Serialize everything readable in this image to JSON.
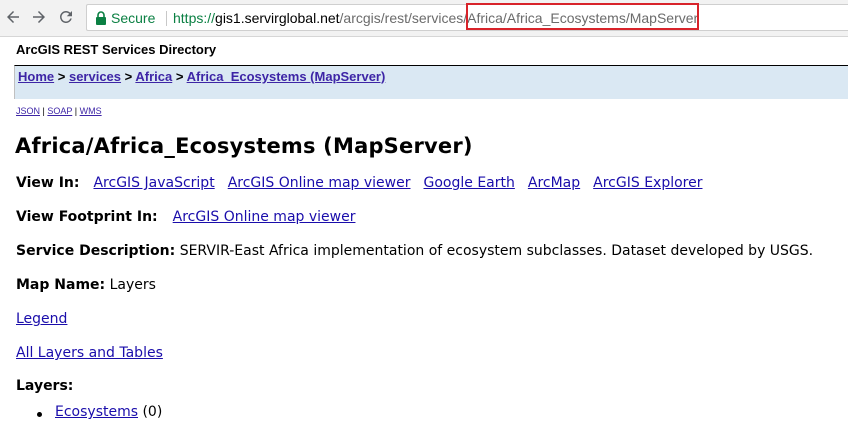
{
  "browser": {
    "secure_label": "Secure",
    "url_scheme": "https://",
    "url_host": "gis1.servirglobal.net",
    "url_path": "/arcgis/rest/services/Africa/Africa_Ecosystems/MapServer"
  },
  "page": {
    "directory_title": "ArcGIS REST Services Directory",
    "breadcrumb": {
      "home": "Home",
      "services": "services",
      "africa": "Africa",
      "current": "Africa_Ecosystems (MapServer)",
      "separator": ">"
    },
    "formats": {
      "json": "JSON",
      "soap": "SOAP",
      "wms": "WMS",
      "separator": "|"
    },
    "title": "Africa/Africa_Ecosystems (MapServer)",
    "view_in": {
      "label": "View In:",
      "links": [
        "ArcGIS JavaScript",
        "ArcGIS Online map viewer",
        "Google Earth",
        "ArcMap",
        "ArcGIS Explorer"
      ]
    },
    "view_footprint": {
      "label": "View Footprint In:",
      "link": "ArcGIS Online map viewer"
    },
    "service_description": {
      "label": "Service Description:",
      "value": "SERVIR-East Africa implementation of ecosystem subclasses. Dataset developed by USGS."
    },
    "map_name": {
      "label": "Map Name:",
      "value": "Layers"
    },
    "legend_link": "Legend",
    "all_layers_link": "All Layers and Tables",
    "layers": {
      "label": "Layers:",
      "items": [
        {
          "name": "Ecosystems",
          "id": "(0)"
        }
      ]
    }
  },
  "colors": {
    "link": "#1a0dab",
    "breadcrumb_bg": "#dae8f3",
    "highlight": "#d8232a",
    "secure": "#0b8043"
  }
}
